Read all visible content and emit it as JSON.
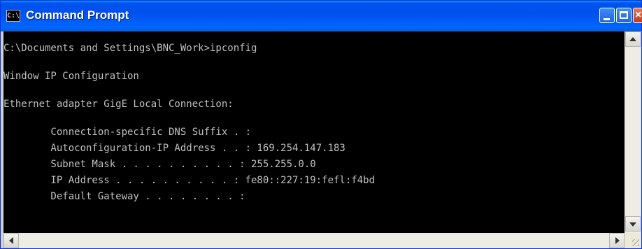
{
  "window": {
    "title": "Command Prompt",
    "icon": "cmd-icon",
    "icon_glyph": "C:\\",
    "controls": {
      "minimize_glyph": "minimize-icon",
      "maximize_glyph": "maximize-icon",
      "close_glyph": "×"
    }
  },
  "console": {
    "lines": [
      "C:\\Documents and Settings\\BNC_Work>ipconfig",
      "",
      "Window IP Configuration",
      "",
      "Ethernet adapter GigE Local Connection:",
      "",
      "        Connection-specific DNS Suffix . :",
      "        Autoconfiguration-IP Address . . : 169.254.147.183",
      "        Subnet Mask . . . . . . . . . . : 255.255.0.0",
      "        IP Address . . . . . . . . . . : fe80::227:19:fefl:f4bd",
      "        Default Gateway . . . . . . . . :"
    ]
  },
  "colors": {
    "console_bg": "#000000",
    "console_fg": "#c0c0c0",
    "titlebar": "#0054e3"
  }
}
